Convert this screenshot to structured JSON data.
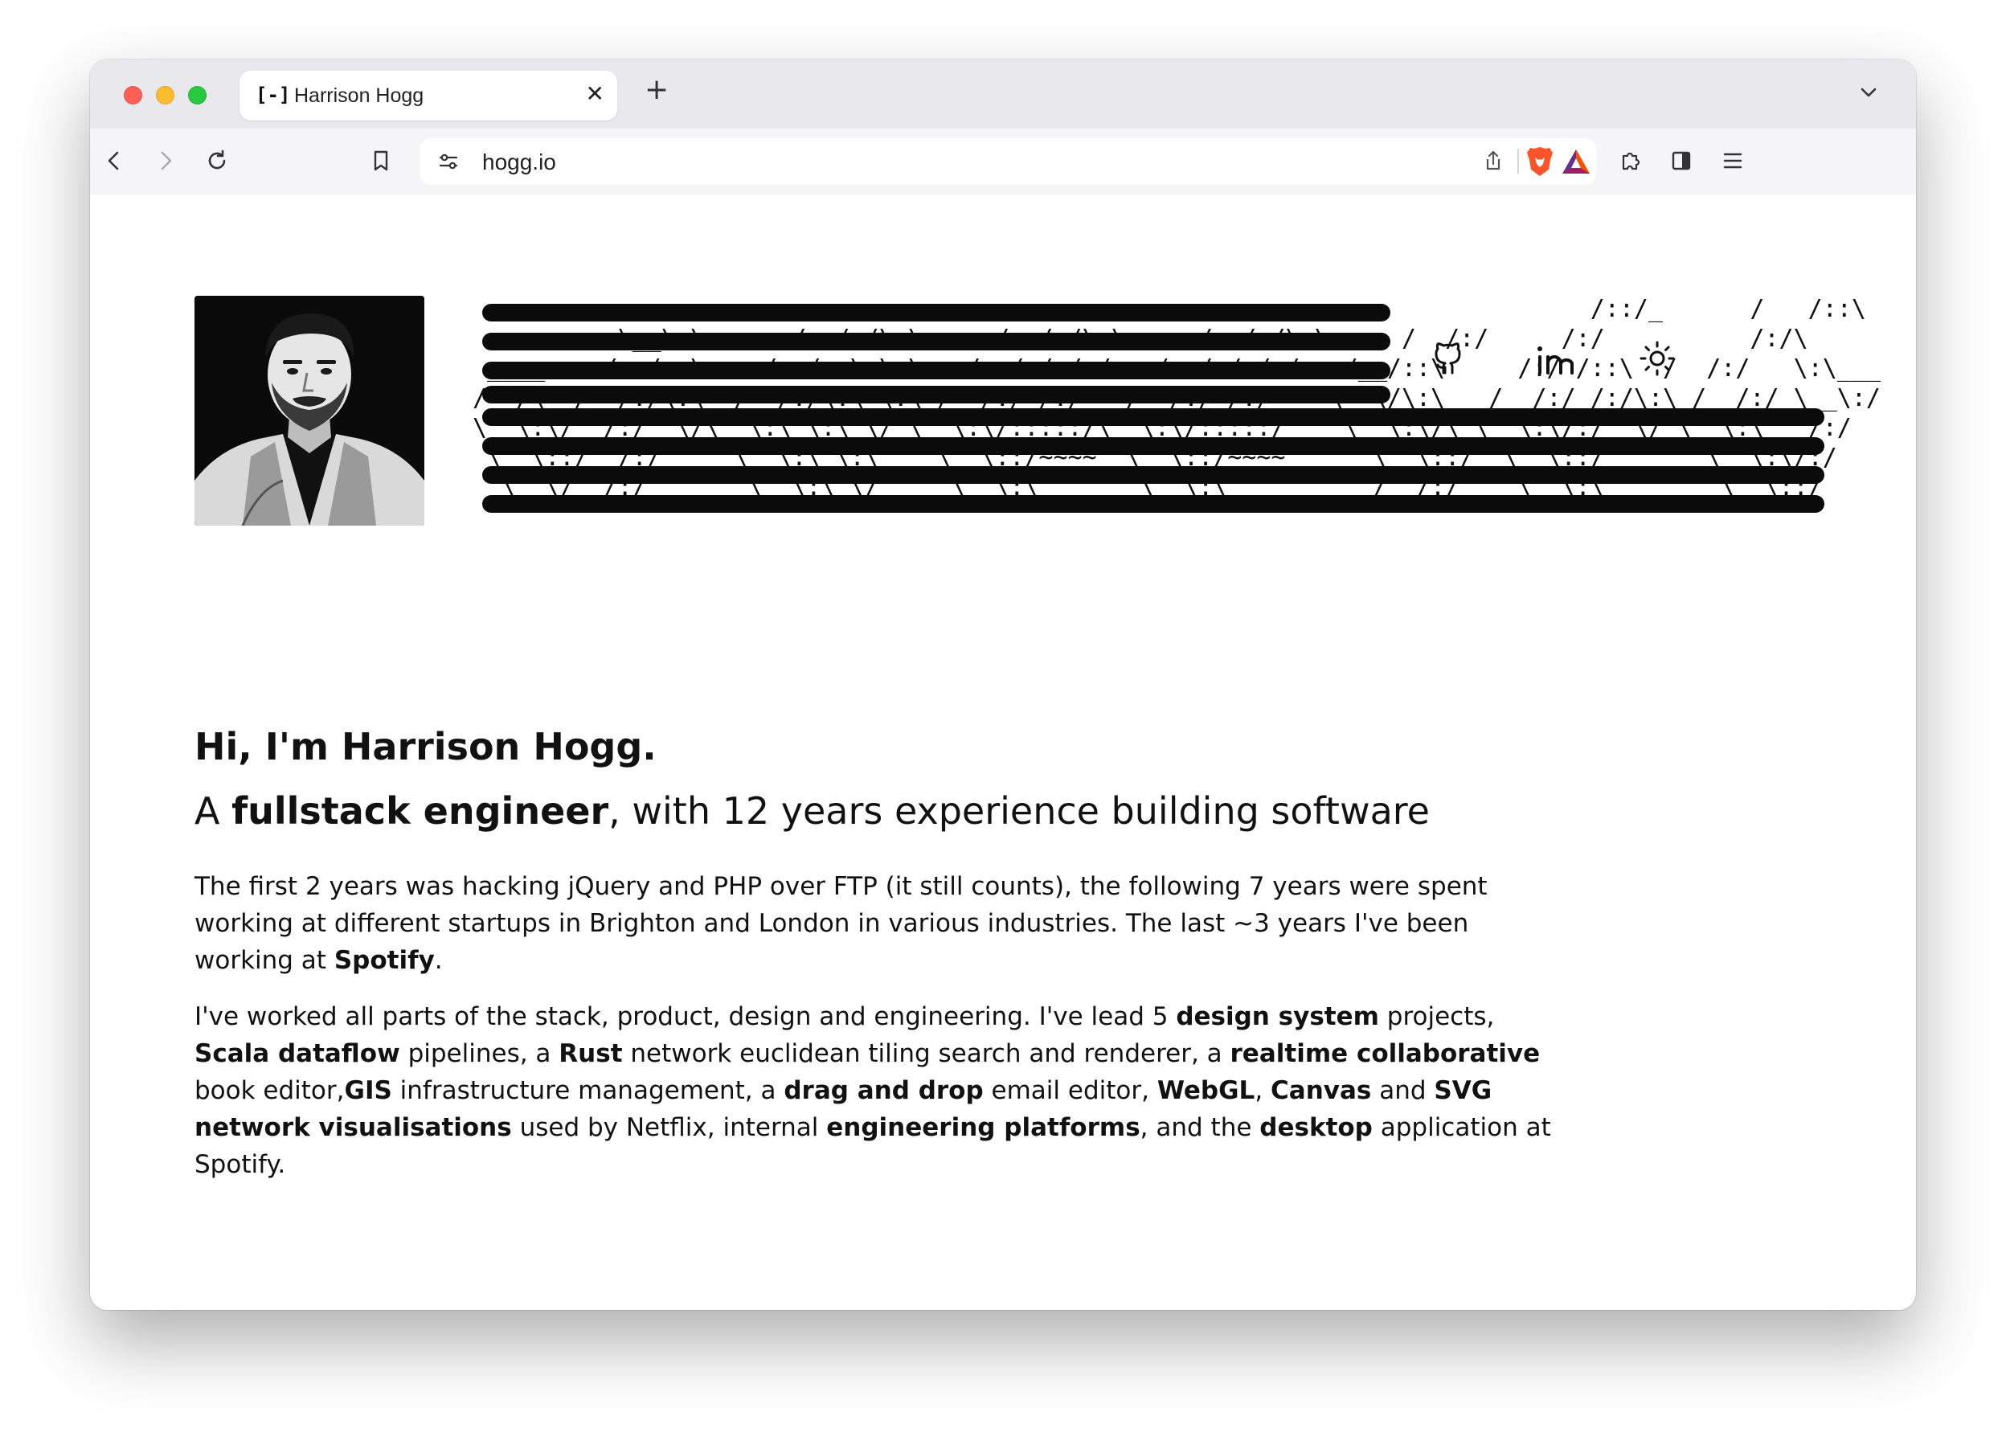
{
  "browser": {
    "tab": {
      "favicon": "[-]",
      "title": "Harrison Hogg",
      "close_icon": "close-icon"
    },
    "new_tab_label": "+",
    "address": {
      "url": "hogg.io"
    },
    "icons": [
      "back-icon",
      "forward-icon",
      "reload-icon",
      "bookmark-icon",
      "site-settings-icon",
      "share-icon",
      "brave-shields-icon",
      "brave-rewards-icon",
      "extensions-icon",
      "sidebar-icon",
      "menu-icon",
      "tab-list-icon"
    ]
  },
  "header": {
    "links": [
      "github-icon",
      "linkedin-icon",
      "theme-toggle-icon"
    ]
  },
  "content": {
    "greeting": "Hi, I'm Harrison Hogg.",
    "tagline": {
      "pre": "A ",
      "emph": "fullstack engineer",
      "post": ", with 12 years experience building software"
    },
    "para1": {
      "t1": "The first 2 years was hacking jQuery and PHP over FTP (it still counts), the following 7 years were spent working at different startups in Brighton and London in various industries. The last ~3 years I've been working at ",
      "b1": "Spotify",
      "t2": "."
    },
    "para2": {
      "t1": "I've worked all parts of the stack, product, design and engineering. I've lead 5 ",
      "b1": "design system",
      "t2": " projects, ",
      "b2": "Scala dataflow",
      "t3": " pipelines, a ",
      "b3": "Rust",
      "t4": " network euclidean tiling search and renderer, a ",
      "b4": "realtime collaborative",
      "t5": " book editor,",
      "b5": "GIS",
      "t6": " infrastructure management, a ",
      "b6": "drag and drop",
      "t7": " email editor, ",
      "b7": "WebGL",
      "t8": ", ",
      "b8": "Canvas",
      "t9": " and ",
      "b9": "SVG network visualisations",
      "t10": " used by Netflix, internal ",
      "b10": "engineering platforms",
      "t11": ", and the ",
      "b11": "desktop",
      "t12": " application at Spotify."
    }
  },
  "colors": {
    "tabbar_bg": "#e8e8ed",
    "toolbar_bg": "#f5f5f7",
    "text": "#111111",
    "brave_orange": "#fb542b"
  }
}
